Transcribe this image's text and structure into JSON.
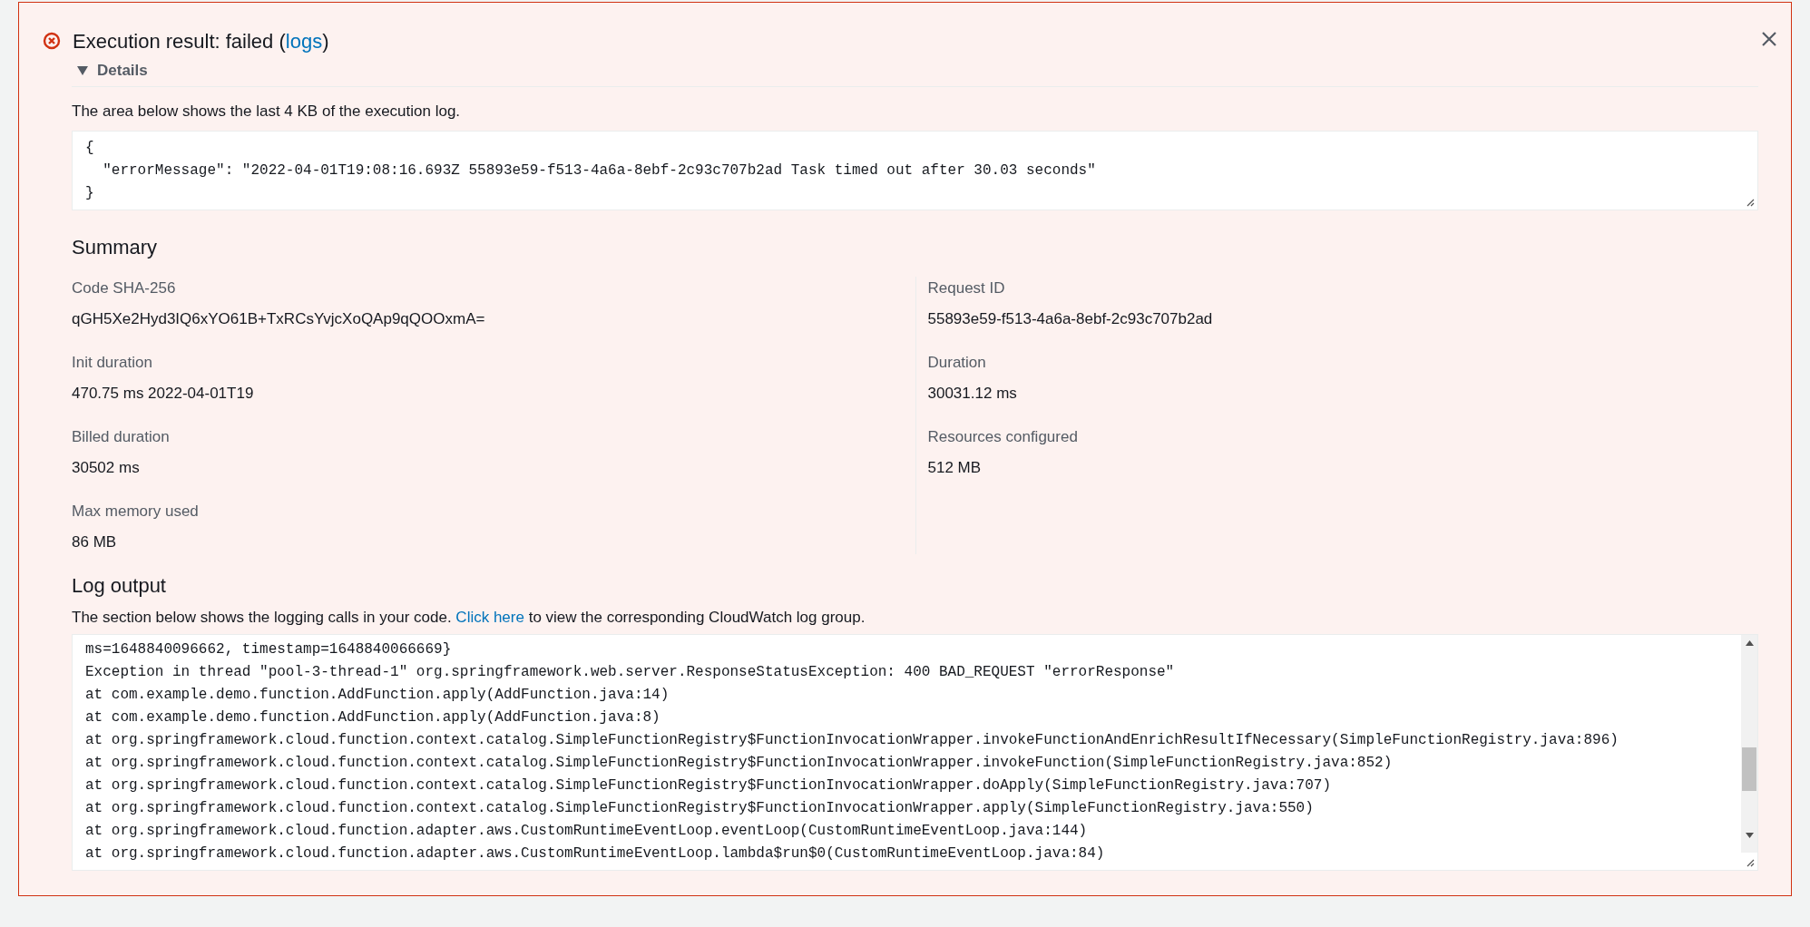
{
  "result": {
    "title_prefix": "Execution result: failed (",
    "title_link": "logs",
    "title_suffix": ")"
  },
  "details": {
    "label": "Details",
    "expanded": true,
    "intro": "The area below shows the last 4 KB of the execution log.",
    "output_lines": [
      "{",
      "  \"errorMessage\": \"2022-04-01T19:08:16.693Z 55893e59-f513-4a6a-8ebf-2c93c707b2ad Task timed out after 30.03 seconds\"",
      "}"
    ]
  },
  "summary": {
    "title": "Summary",
    "left": [
      {
        "label": "Code SHA-256",
        "value": "qGH5Xe2Hyd3IQ6xYO61B+TxRCsYvjcXoQAp9qQOOxmA="
      },
      {
        "label": "Init duration",
        "value": "470.75 ms 2022-04-01T19"
      },
      {
        "label": "Billed duration",
        "value": "30502 ms"
      },
      {
        "label": "Max memory used",
        "value": "86 MB"
      }
    ],
    "right": [
      {
        "label": "Request ID",
        "value": "55893e59-f513-4a6a-8ebf-2c93c707b2ad"
      },
      {
        "label": "Duration",
        "value": "30031.12 ms"
      },
      {
        "label": "Resources configured",
        "value": "512 MB"
      }
    ]
  },
  "log_output": {
    "title": "Log output",
    "desc_prefix": "The section below shows the logging calls in your code. ",
    "desc_link": "Click here",
    "desc_suffix": " to view the corresponding CloudWatch log group.",
    "lines": [
      "ms=1648840096662, timestamp=1648840066669}",
      "Exception in thread \"pool-3-thread-1\" org.springframework.web.server.ResponseStatusException: 400 BAD_REQUEST \"errorResponse\"",
      "at com.example.demo.function.AddFunction.apply(AddFunction.java:14)",
      "at com.example.demo.function.AddFunction.apply(AddFunction.java:8)",
      "at org.springframework.cloud.function.context.catalog.SimpleFunctionRegistry$FunctionInvocationWrapper.invokeFunctionAndEnrichResultIfNecessary(SimpleFunctionRegistry.java:896)",
      "at org.springframework.cloud.function.context.catalog.SimpleFunctionRegistry$FunctionInvocationWrapper.invokeFunction(SimpleFunctionRegistry.java:852)",
      "at org.springframework.cloud.function.context.catalog.SimpleFunctionRegistry$FunctionInvocationWrapper.doApply(SimpleFunctionRegistry.java:707)",
      "at org.springframework.cloud.function.context.catalog.SimpleFunctionRegistry$FunctionInvocationWrapper.apply(SimpleFunctionRegistry.java:550)",
      "at org.springframework.cloud.function.adapter.aws.CustomRuntimeEventLoop.eventLoop(CustomRuntimeEventLoop.java:144)",
      "at org.springframework.cloud.function.adapter.aws.CustomRuntimeEventLoop.lambda$run$0(CustomRuntimeEventLoop.java:84)"
    ]
  }
}
